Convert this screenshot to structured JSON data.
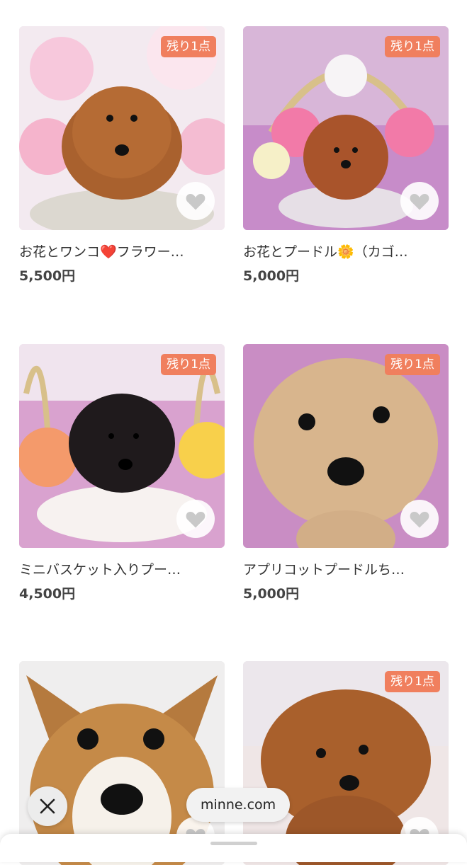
{
  "products": [
    {
      "title": "お花とワンコ❤️フラワー…",
      "price": "5,500円",
      "badge": "残り1点"
    },
    {
      "title": "お花とプードル🌼（カゴ…",
      "price": "5,000円",
      "badge": "残り1点"
    },
    {
      "title": "ミニバスケット入りプー…",
      "price": "4,500円",
      "badge": "残り1点"
    },
    {
      "title": "アプリコットプードルち…",
      "price": "5,000円",
      "badge": "残り1点"
    },
    {
      "title": "",
      "price": "",
      "badge": ""
    },
    {
      "title": "",
      "price": "",
      "badge": "残り1点"
    }
  ],
  "browser": {
    "url": "minne.com"
  },
  "icons": {
    "favorite": "heart-icon",
    "close": "close-icon"
  },
  "colors": {
    "badge": "#f07f5e"
  }
}
